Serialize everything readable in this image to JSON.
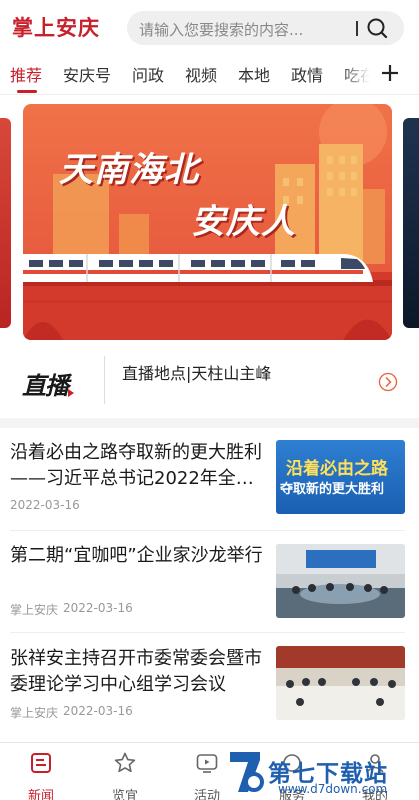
{
  "header": {
    "logo": "掌上安庆",
    "search_placeholder": "请输入您要搜索的内容..."
  },
  "tabs": [
    "推荐",
    "安庆号",
    "问政",
    "视频",
    "本地",
    "政情",
    "吃在"
  ],
  "banner": {
    "line1": "天南海北",
    "line2": "安庆人"
  },
  "live": {
    "logo": "直播",
    "text": "直播地点|天柱山主峰"
  },
  "news": [
    {
      "title": "沿着必由之路夺取新的更大胜利——习近平总书记2022年全…",
      "source": "",
      "date": "2022-03-16",
      "thumb": {
        "line1": "沿着必由之路",
        "line2": "夺取新的更大胜利"
      }
    },
    {
      "title": "第二期“宜咖吧”企业家沙龙举行",
      "source": "掌上安庆",
      "date": "2022-03-16"
    },
    {
      "title": "张祥安主持召开市委常委会暨市委理论学习中心组学习会议",
      "source": "掌上安庆",
      "date": "2022-03-16"
    }
  ],
  "bottom_nav": [
    {
      "label": "新闻",
      "icon": "news-icon",
      "active": true
    },
    {
      "label": "览宜",
      "icon": "star-icon",
      "active": false
    },
    {
      "label": "活动",
      "icon": "tv-icon",
      "active": false
    },
    {
      "label": "服务",
      "icon": "service-icon",
      "active": false
    },
    {
      "label": "我的",
      "icon": "user-icon",
      "active": false
    }
  ],
  "watermark": {
    "title": "第七下载站",
    "url": "www.d7down.com"
  },
  "colors": {
    "accent": "#c8202a",
    "banner_bg": "#e85a3c",
    "muted": "#999999"
  }
}
